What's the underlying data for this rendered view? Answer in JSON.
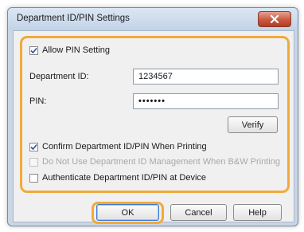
{
  "dialog": {
    "title": "Department ID/PIN Settings",
    "close_icon": "close-icon"
  },
  "settings": {
    "allow_pin": {
      "label": "Allow PIN Setting",
      "checked": true
    },
    "department_id": {
      "label": "Department ID:",
      "value": "1234567"
    },
    "pin": {
      "label": "PIN:",
      "value": "•••••••"
    },
    "verify_label": "Verify",
    "confirm_when_printing": {
      "label": "Confirm Department ID/PIN When Printing",
      "checked": true
    },
    "do_not_use_bw": {
      "label": "Do Not Use Department ID Management When B&W Printing",
      "checked": false,
      "disabled": true
    },
    "authenticate_at_device": {
      "label": "Authenticate Department ID/PIN at Device",
      "checked": false
    }
  },
  "buttons": {
    "ok": "OK",
    "cancel": "Cancel",
    "help": "Help"
  },
  "colors": {
    "highlight": "#f2a93b",
    "close_button": "#c85a40"
  }
}
